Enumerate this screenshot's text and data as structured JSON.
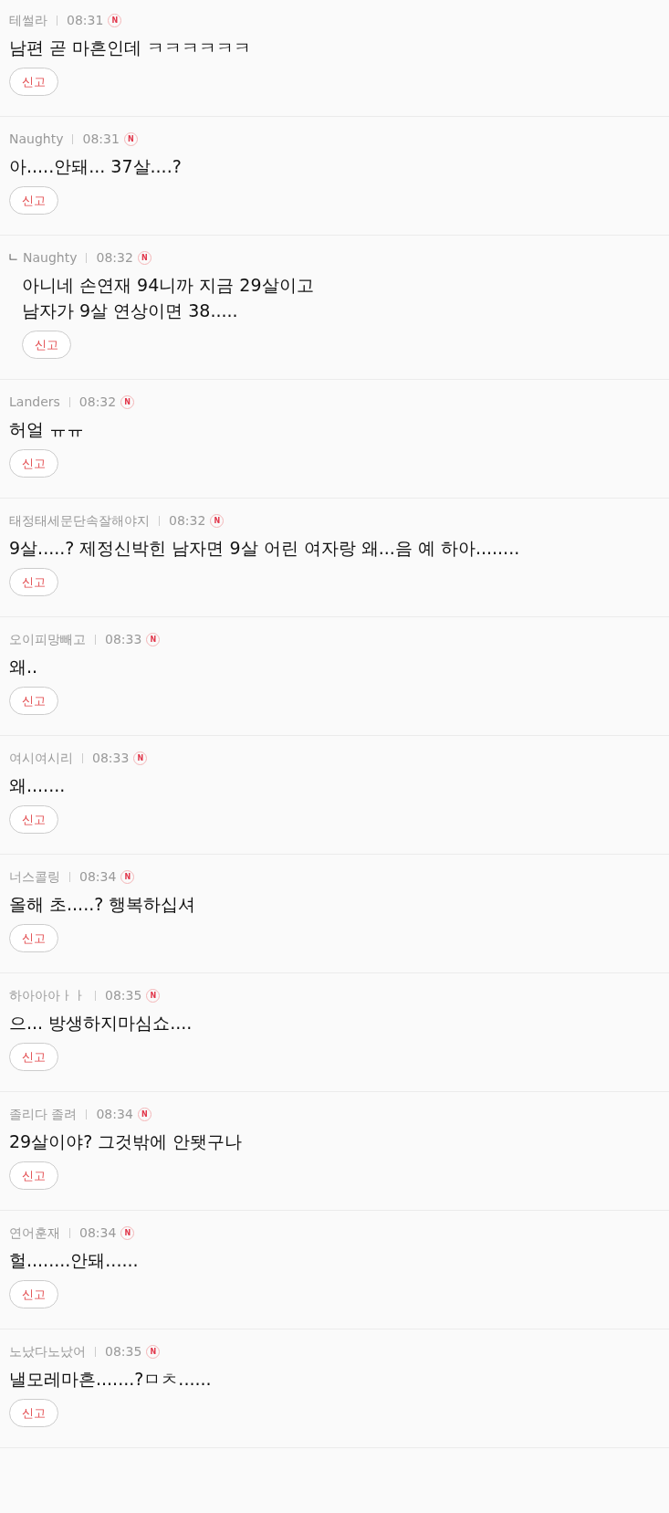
{
  "comments": [
    {
      "kind": "comment",
      "author": "테썰라",
      "time": "08:31",
      "badge": "N",
      "lines": [
        "남편 곧 마흔인데 ㅋㅋㅋㅋㅋㅋ"
      ],
      "report_button": "신고"
    },
    {
      "kind": "comment",
      "author": "Naughty",
      "time": "08:31",
      "badge": "N",
      "lines": [
        "아.....안돼... 37살....?"
      ],
      "report_button": "신고"
    },
    {
      "kind": "reply",
      "reply_mark": "ㄴ",
      "author": "Naughty",
      "time": "08:32",
      "badge": "N",
      "lines": [
        "아니네 손연재 94니까 지금 29살이고",
        "남자가 9살 연상이면 38....."
      ],
      "report_button": "신고"
    },
    {
      "kind": "comment",
      "author": "Landers",
      "time": "08:32",
      "badge": "N",
      "lines": [
        "허얼 ㅠㅠ"
      ],
      "report_button": "신고"
    },
    {
      "kind": "comment",
      "author": "태정태세문단속잘해야지",
      "time": "08:32",
      "badge": "N",
      "lines": [
        "9살.....? 제정신박힌 남자면 9살 어린 여자랑 왜...음 예 하아........"
      ],
      "report_button": "신고"
    },
    {
      "kind": "comment",
      "author": "오이피망빼고",
      "time": "08:33",
      "badge": "N",
      "lines": [
        "왜.."
      ],
      "report_button": "신고"
    },
    {
      "kind": "comment",
      "author": "여시여시리",
      "time": "08:33",
      "badge": "N",
      "lines": [
        "왜......."
      ],
      "report_button": "신고"
    },
    {
      "kind": "comment",
      "author": "너스콜링",
      "time": "08:34",
      "badge": "N",
      "lines": [
        "올해 초.....? 행복하십셔"
      ],
      "report_button": "신고"
    },
    {
      "kind": "comment",
      "author": "하아아아ㅏㅏ",
      "time": "08:35",
      "badge": "N",
      "lines": [
        "으... 방생하지마심쇼...."
      ],
      "report_button": "신고"
    },
    {
      "kind": "comment",
      "author": "졸리다 졸려",
      "time": "08:34",
      "badge": "N",
      "lines": [
        "29살이야? 그것밖에 안됏구나"
      ],
      "report_button": "신고"
    },
    {
      "kind": "comment",
      "author": "연어훈재",
      "time": "08:34",
      "badge": "N",
      "lines": [
        "헐........안돼......"
      ],
      "report_button": "신고"
    },
    {
      "kind": "comment",
      "author": "노났다노났어",
      "time": "08:35",
      "badge": "N",
      "lines": [
        "낼모레마흔.......?ㅁㅊ......"
      ],
      "report_button": "신고"
    }
  ]
}
